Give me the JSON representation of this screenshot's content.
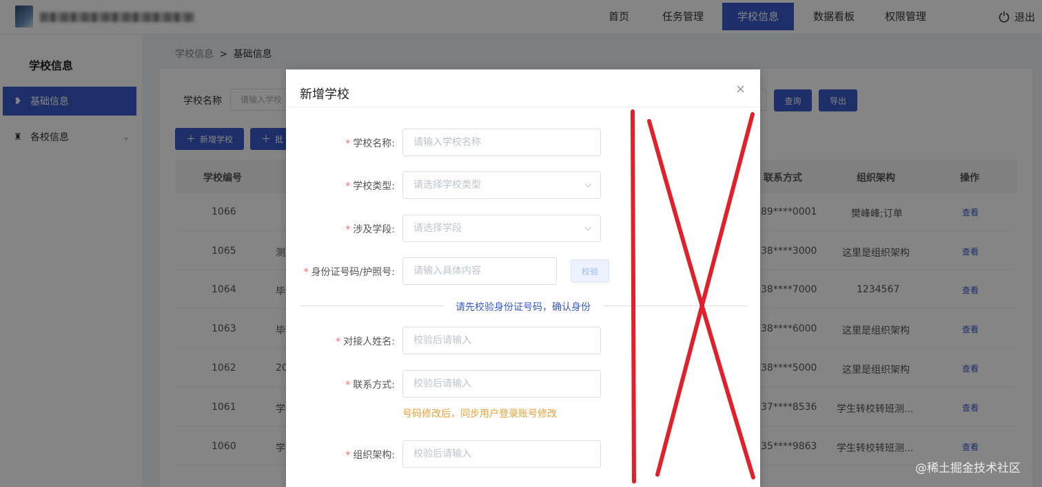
{
  "header": {
    "nav": [
      "首页",
      "任务管理",
      "学校信息",
      "数据看板",
      "权限管理"
    ],
    "active_nav": "学校信息",
    "logout": "退出"
  },
  "sidebar": {
    "title": "学校信息",
    "items": [
      {
        "label": "基础信息",
        "icon": "school-icon",
        "active": true
      },
      {
        "label": "各校信息",
        "icon": "building-icon",
        "active": false
      }
    ]
  },
  "breadcrumb": {
    "parent": "学校信息",
    "separator": ">",
    "current": "基础信息"
  },
  "filter": {
    "label": "学校名称",
    "placeholder": "请输入学校",
    "query_button": "查询",
    "export_button": "导出"
  },
  "toolbar": {
    "add_button": "新增学校",
    "batch_button": "批"
  },
  "table": {
    "headers": {
      "id": "学校编号",
      "contact": "联系方式",
      "org": "组织架构",
      "action": "操作"
    },
    "rows": [
      {
        "id": "1066",
        "name": "",
        "contact": "89****0001",
        "org": "樊峰峰;订单",
        "action": "查看"
      },
      {
        "id": "1065",
        "name": "测",
        "contact": "38****3000",
        "org": "这里是组织架构",
        "action": "查看"
      },
      {
        "id": "1064",
        "name": "毕",
        "contact": "38****7000",
        "org": "1234567",
        "action": "查看"
      },
      {
        "id": "1063",
        "name": "毕",
        "contact": "38****6000",
        "org": "这里是组织架构",
        "action": "查看"
      },
      {
        "id": "1062",
        "name": "20",
        "contact": "38****5000",
        "org": "这里是组织架构",
        "action": "查看"
      },
      {
        "id": "1061",
        "name": "学",
        "contact": "37****8536",
        "org": "学生转校转班测...",
        "action": "查看"
      },
      {
        "id": "1060",
        "name": "学",
        "contact": "35****9863",
        "org": "学生转校转班测...",
        "action": "查看"
      }
    ]
  },
  "modal": {
    "title": "新增学校",
    "close": "×",
    "fields": [
      {
        "label": "学校名称:",
        "placeholder": "请输入学校名称",
        "type": "input"
      },
      {
        "label": "学校类型:",
        "placeholder": "请选择学校类型",
        "type": "select"
      },
      {
        "label": "涉及学段:",
        "placeholder": "请选择学段",
        "type": "select"
      },
      {
        "label": "身份证号码/护照号:",
        "placeholder": "请输入具体内容",
        "type": "input"
      },
      {
        "label": "对接人姓名:",
        "placeholder": "校验后请输入",
        "type": "input"
      },
      {
        "label": "联系方式:",
        "placeholder": "校验后请输入",
        "type": "input"
      },
      {
        "label": "组织架构:",
        "placeholder": "校验后请输入",
        "type": "input"
      }
    ],
    "required_mark": "*",
    "verify_button": "校验",
    "divider_text": "请先校验身份证号码，确认身份",
    "phone_hint": "号码修改后，同步用户登录账号修改"
  },
  "annotation": {
    "color": "#e0202a"
  },
  "watermark": "@稀土掘金技术社区",
  "colors": {
    "primary": "#3858c8",
    "required": "#f56c6c",
    "warning": "#e6a23c"
  }
}
